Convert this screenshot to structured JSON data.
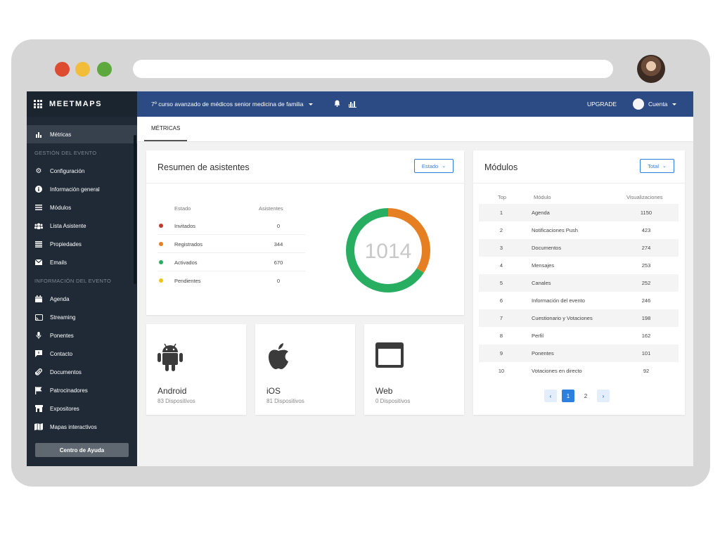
{
  "colors": {
    "sidebar": "#1f2a36",
    "topbar": "#2c4a83",
    "accent": "#2e80e0",
    "invitados": "#c0392b",
    "registrados": "#e67e22",
    "activados": "#27ae60",
    "pendientes": "#f1c40f"
  },
  "sidebar": {
    "logo": "MEETMAPS",
    "active_item": {
      "label": "Métricas",
      "icon": "bar-chart-icon"
    },
    "section_gestion": "GESTIÓN DEL EVENTO",
    "gestion_items": [
      {
        "label": "Configuración",
        "icon": "gear-icon"
      },
      {
        "label": "Información general",
        "icon": "info-icon"
      },
      {
        "label": "Módulos",
        "icon": "menu-icon"
      },
      {
        "label": "Lista Asistente",
        "icon": "users-icon"
      },
      {
        "label": "Propiedades",
        "icon": "list-icon"
      },
      {
        "label": "Emails",
        "icon": "envelope-icon"
      }
    ],
    "section_info": "INFORMACIÓN DEL EVENTO",
    "info_items": [
      {
        "label": "Agenda",
        "icon": "calendar-icon"
      },
      {
        "label": "Streaming",
        "icon": "cast-icon"
      },
      {
        "label": "Ponentes",
        "icon": "microphone-icon"
      },
      {
        "label": "Contacto",
        "icon": "chat-icon"
      },
      {
        "label": "Documentos",
        "icon": "paperclip-icon"
      },
      {
        "label": "Patrocinadores",
        "icon": "flag-icon"
      },
      {
        "label": "Expositores",
        "icon": "store-icon"
      },
      {
        "label": "Mapas interactivos",
        "icon": "map-icon"
      }
    ],
    "help_button": "Centro de Ayuda"
  },
  "topbar": {
    "event_title": "7º curso avanzado de médicos senior medicina de familia",
    "upgrade": "UPGRADE",
    "account": "Cuenta"
  },
  "tabs": {
    "active": "MÉTRICAS"
  },
  "attendees": {
    "title": "Resumen de asistentes",
    "filter": "Estado",
    "col_estado": "Estado",
    "col_asistentes": "Asistentes",
    "rows": [
      {
        "name": "Invitados",
        "value": "0"
      },
      {
        "name": "Registrados",
        "value": "344"
      },
      {
        "name": "Activados",
        "value": "670"
      },
      {
        "name": "Pendientes",
        "value": "0"
      }
    ],
    "total": "1014"
  },
  "chart_data": {
    "type": "pie",
    "categories": [
      "Invitados",
      "Registrados",
      "Activados",
      "Pendientes"
    ],
    "values": [
      0,
      344,
      670,
      0
    ],
    "title": "Resumen de asistentes",
    "center_label": "1014"
  },
  "devices": [
    {
      "name": "Android",
      "count": "83 Dispositivos",
      "icon": "android-icon"
    },
    {
      "name": "iOS",
      "count": "81 Dispositivos",
      "icon": "apple-icon"
    },
    {
      "name": "Web",
      "count": "0 Dispositivos",
      "icon": "browser-window-icon"
    }
  ],
  "modules": {
    "title": "Módulos",
    "filter": "Total",
    "col_top": "Top",
    "col_modulo": "Módulo",
    "col_visual": "Visualizaciones",
    "rows": [
      {
        "top": "1",
        "module": "Agenda",
        "views": "1150"
      },
      {
        "top": "2",
        "module": "Notificaciones Push",
        "views": "423"
      },
      {
        "top": "3",
        "module": "Documentos",
        "views": "274"
      },
      {
        "top": "4",
        "module": "Mensajes",
        "views": "253"
      },
      {
        "top": "5",
        "module": "Canales",
        "views": "252"
      },
      {
        "top": "6",
        "module": "Información del evento",
        "views": "246"
      },
      {
        "top": "7",
        "module": "Cuestionario y Votaciones",
        "views": "198"
      },
      {
        "top": "8",
        "module": "Perfil",
        "views": "162"
      },
      {
        "top": "9",
        "module": "Ponentes",
        "views": "101"
      },
      {
        "top": "10",
        "module": "Votaciones en directo",
        "views": "92"
      }
    ],
    "pagination": {
      "prev": "‹",
      "page1": "1",
      "page2": "2",
      "next": "›"
    }
  }
}
